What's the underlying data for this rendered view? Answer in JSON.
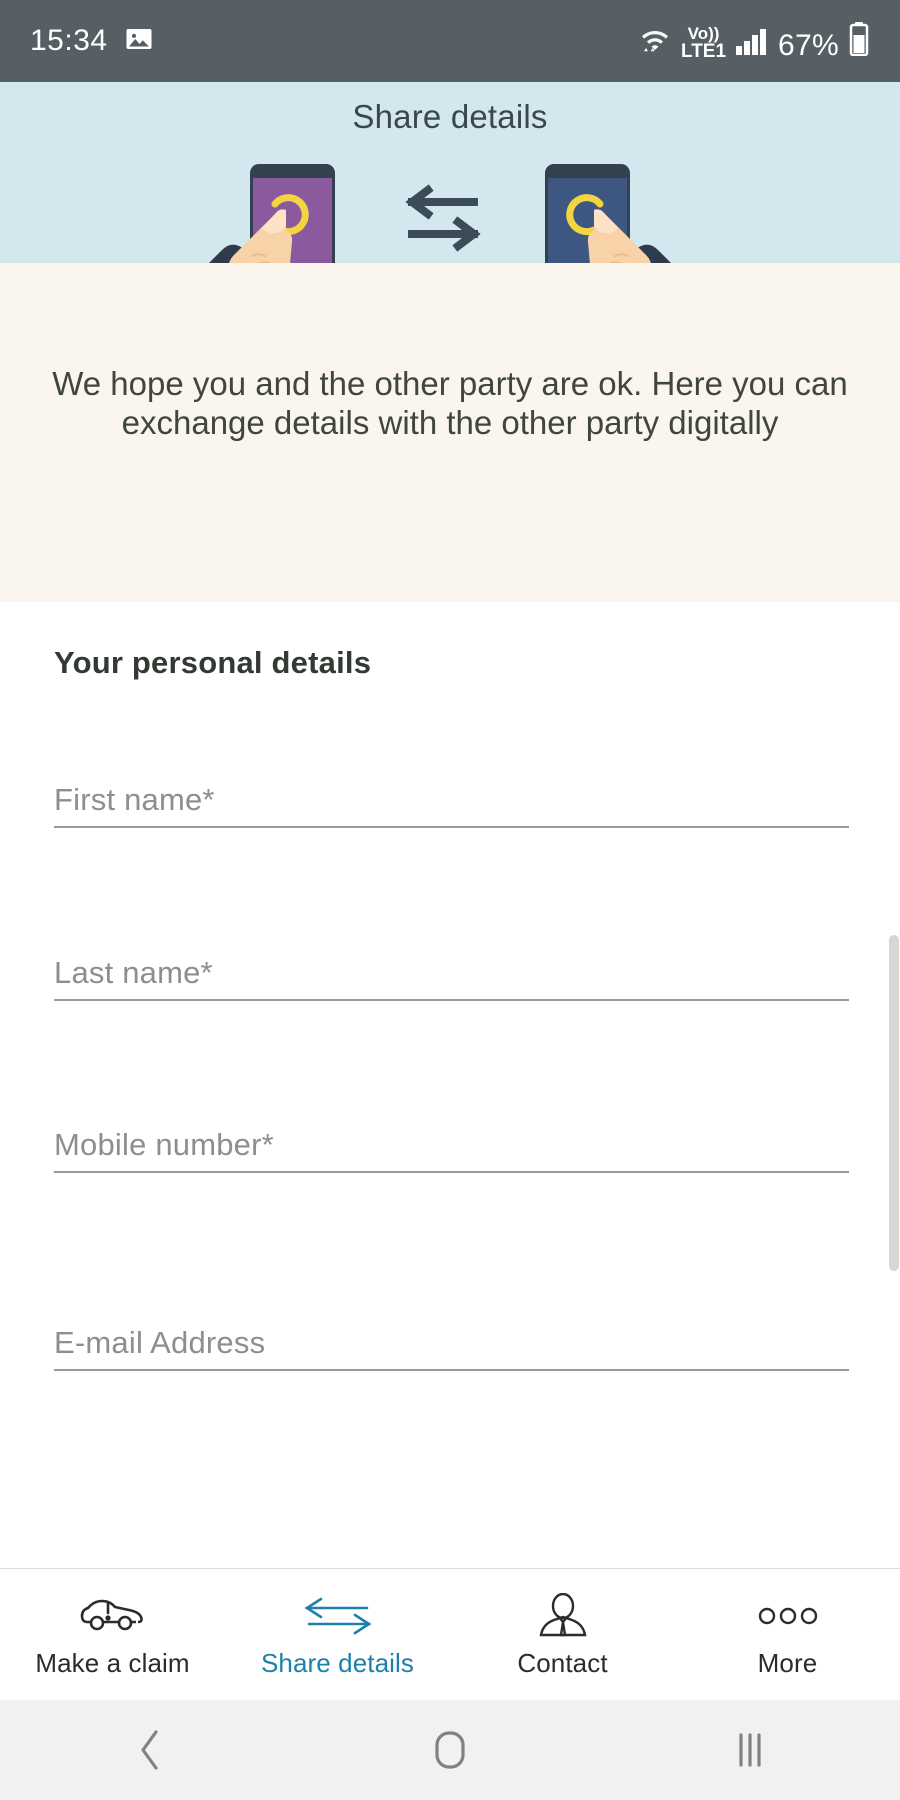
{
  "statusbar": {
    "time": "15:34",
    "battery_percent": "67%",
    "network_label_top": "Vo))",
    "network_label_bottom": "LTE1",
    "icons": [
      "image-icon",
      "wifi-icon",
      "volte-icon",
      "signal-icon",
      "battery-icon"
    ]
  },
  "header": {
    "title": "Share details",
    "background_color": "#d3e7ee",
    "illustration": {
      "left_phone_color": "#8b5a9e",
      "right_phone_color": "#3e5682",
      "bezel_color": "#32404f",
      "touch_ring_color": "#f2d541",
      "skin_color": "#f8d2a8",
      "sleeve_color": "#2f3a4d",
      "arrow_color": "#3d4a57"
    }
  },
  "info": {
    "message": "We hope you and the other party are ok. Here you can exchange details with the other party digitally",
    "background_color": "#faf5ed",
    "text_color": "#3f463f"
  },
  "form": {
    "section_title": "Your personal details",
    "fields": [
      {
        "name": "first-name",
        "placeholder": "First name*",
        "value": ""
      },
      {
        "name": "last-name",
        "placeholder": "Last name*",
        "value": ""
      },
      {
        "name": "mobile-number",
        "placeholder": "Mobile number*",
        "value": ""
      },
      {
        "name": "email-address",
        "placeholder": "E-mail Address",
        "value": ""
      }
    ]
  },
  "tabbar": {
    "active_color": "#1d80ac",
    "inactive_color": "#2b2b2b",
    "items": [
      {
        "label": "Make a claim",
        "icon": "car-alert-icon",
        "active": false
      },
      {
        "label": "Share details",
        "icon": "exchange-arrows-icon",
        "active": true
      },
      {
        "label": "Contact",
        "icon": "person-suit-icon",
        "active": false
      },
      {
        "label": "More",
        "icon": "three-dots-icon",
        "active": false
      }
    ]
  },
  "androidnav": {
    "back": "back-chevron-icon",
    "home": "home-square-icon",
    "recents": "recents-bars-icon"
  }
}
